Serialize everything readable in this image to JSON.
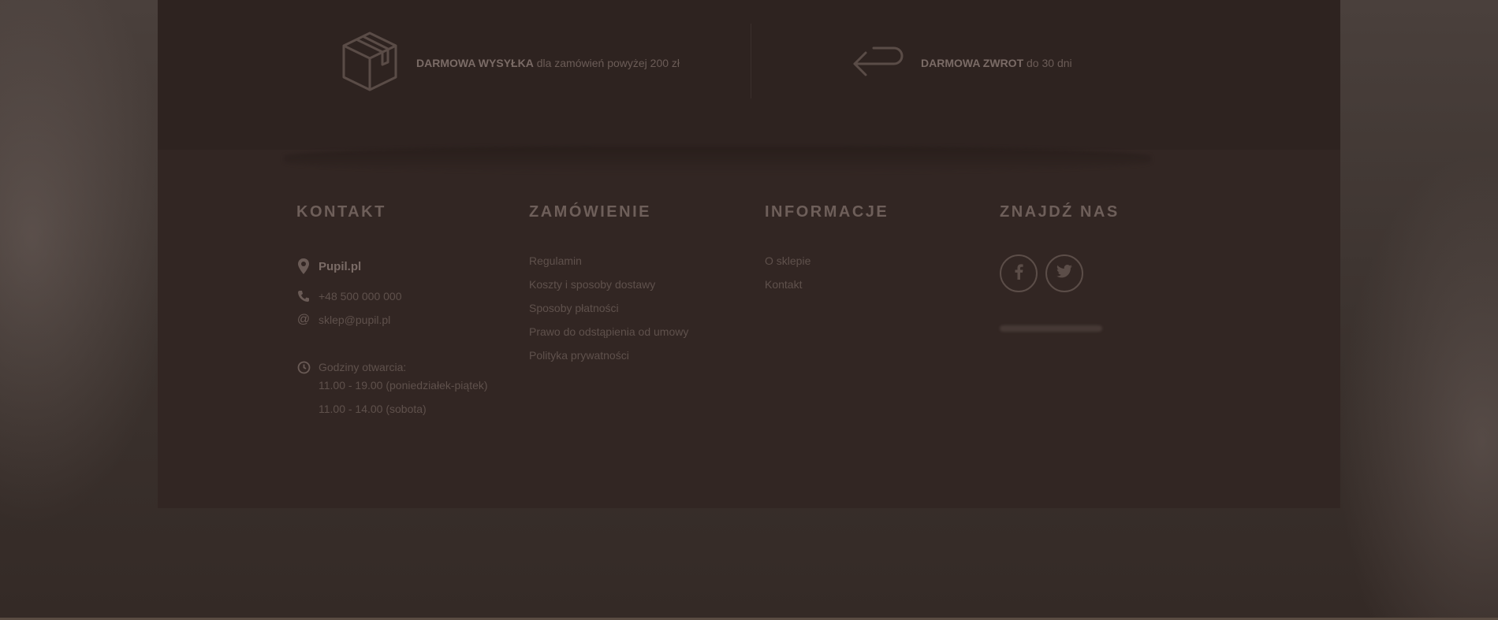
{
  "perks": [
    {
      "bold": "DARMOWA WYSYŁKA",
      "text": "dla zamówień powyżej 200 zł",
      "icon": "box-icon"
    },
    {
      "bold": "DARMOWA ZWROT",
      "text": "do 30 dni",
      "icon": "return-arrow-icon"
    }
  ],
  "kontakt": {
    "heading": "KONTAKT",
    "name": "Pupil.pl",
    "phone": "+48 500 000 000",
    "email": "sklep@pupil.pl",
    "hours_label": "Godziny otwarcia:",
    "hours": [
      "11.00 - 19.00 (poniedziałek-piątek)",
      "11.00 - 14.00 (sobota)"
    ]
  },
  "zamowienie": {
    "heading": "ZAMÓWIENIE",
    "links": [
      "Regulamin",
      "Koszty i sposoby dostawy",
      "Sposoby płatności",
      "Prawo do odstąpienia od umowy",
      "Polityka prywatności"
    ]
  },
  "informacje": {
    "heading": "INFORMACJE",
    "links": [
      "O sklepie",
      "Kontakt"
    ]
  },
  "znajdz": {
    "heading": "ZNAJDŹ NAS",
    "socials": [
      "facebook-icon",
      "twitter-icon"
    ]
  },
  "colors": {
    "background": "#3a2f2b",
    "panel": "#322623",
    "text": "#5f514c",
    "heading": "#6e5f5a"
  }
}
